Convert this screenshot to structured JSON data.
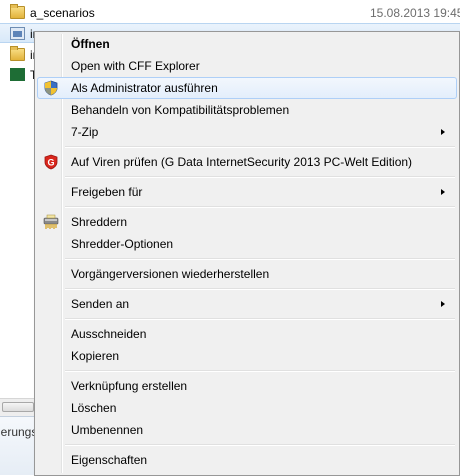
{
  "files": [
    {
      "name": "a_scenarios",
      "date": "15.08.2013 19:45",
      "icon": "folder-icon"
    },
    {
      "name": "in",
      "date": "",
      "icon": "executable-icon"
    },
    {
      "name": "in",
      "date": "",
      "icon": "folder-icon"
    },
    {
      "name": "T",
      "date": "",
      "icon": "application-icon"
    }
  ],
  "details_fragment": "ierungs",
  "context_menu": {
    "items": [
      {
        "id": "open",
        "label": "Öffnen",
        "bold": true
      },
      {
        "id": "open-cff",
        "label": "Open with CFF Explorer"
      },
      {
        "id": "run-admin",
        "label": "Als Administrator ausführen",
        "icon": "uac-shield-icon",
        "highlighted": true
      },
      {
        "id": "compat",
        "label": "Behandeln von Kompatibilitätsproblemen"
      },
      {
        "id": "7zip",
        "label": "7-Zip",
        "submenu": true
      },
      {
        "id": "virus",
        "label": "Auf Viren prüfen (G Data InternetSecurity 2013 PC-Welt Edition)",
        "icon": "gdata-icon"
      },
      {
        "id": "share",
        "label": "Freigeben für",
        "submenu": true
      },
      {
        "id": "shred",
        "label": "Shreddern",
        "icon": "shredder-icon"
      },
      {
        "id": "shred-opt",
        "label": "Shredder-Optionen"
      },
      {
        "id": "restore",
        "label": "Vorgängerversionen wiederherstellen"
      },
      {
        "id": "sendto",
        "label": "Senden an",
        "submenu": true
      },
      {
        "id": "cut",
        "label": "Ausschneiden"
      },
      {
        "id": "copy",
        "label": "Kopieren"
      },
      {
        "id": "shortcut",
        "label": "Verknüpfung erstellen"
      },
      {
        "id": "delete",
        "label": "Löschen"
      },
      {
        "id": "rename",
        "label": "Umbenennen"
      },
      {
        "id": "properties",
        "label": "Eigenschaften"
      }
    ]
  },
  "colors": {
    "menu_bg": "#f0f0f0",
    "highlight_border": "#aecff7",
    "selection_bg": "#d9e9f9",
    "date_text": "#6d6d6d"
  }
}
